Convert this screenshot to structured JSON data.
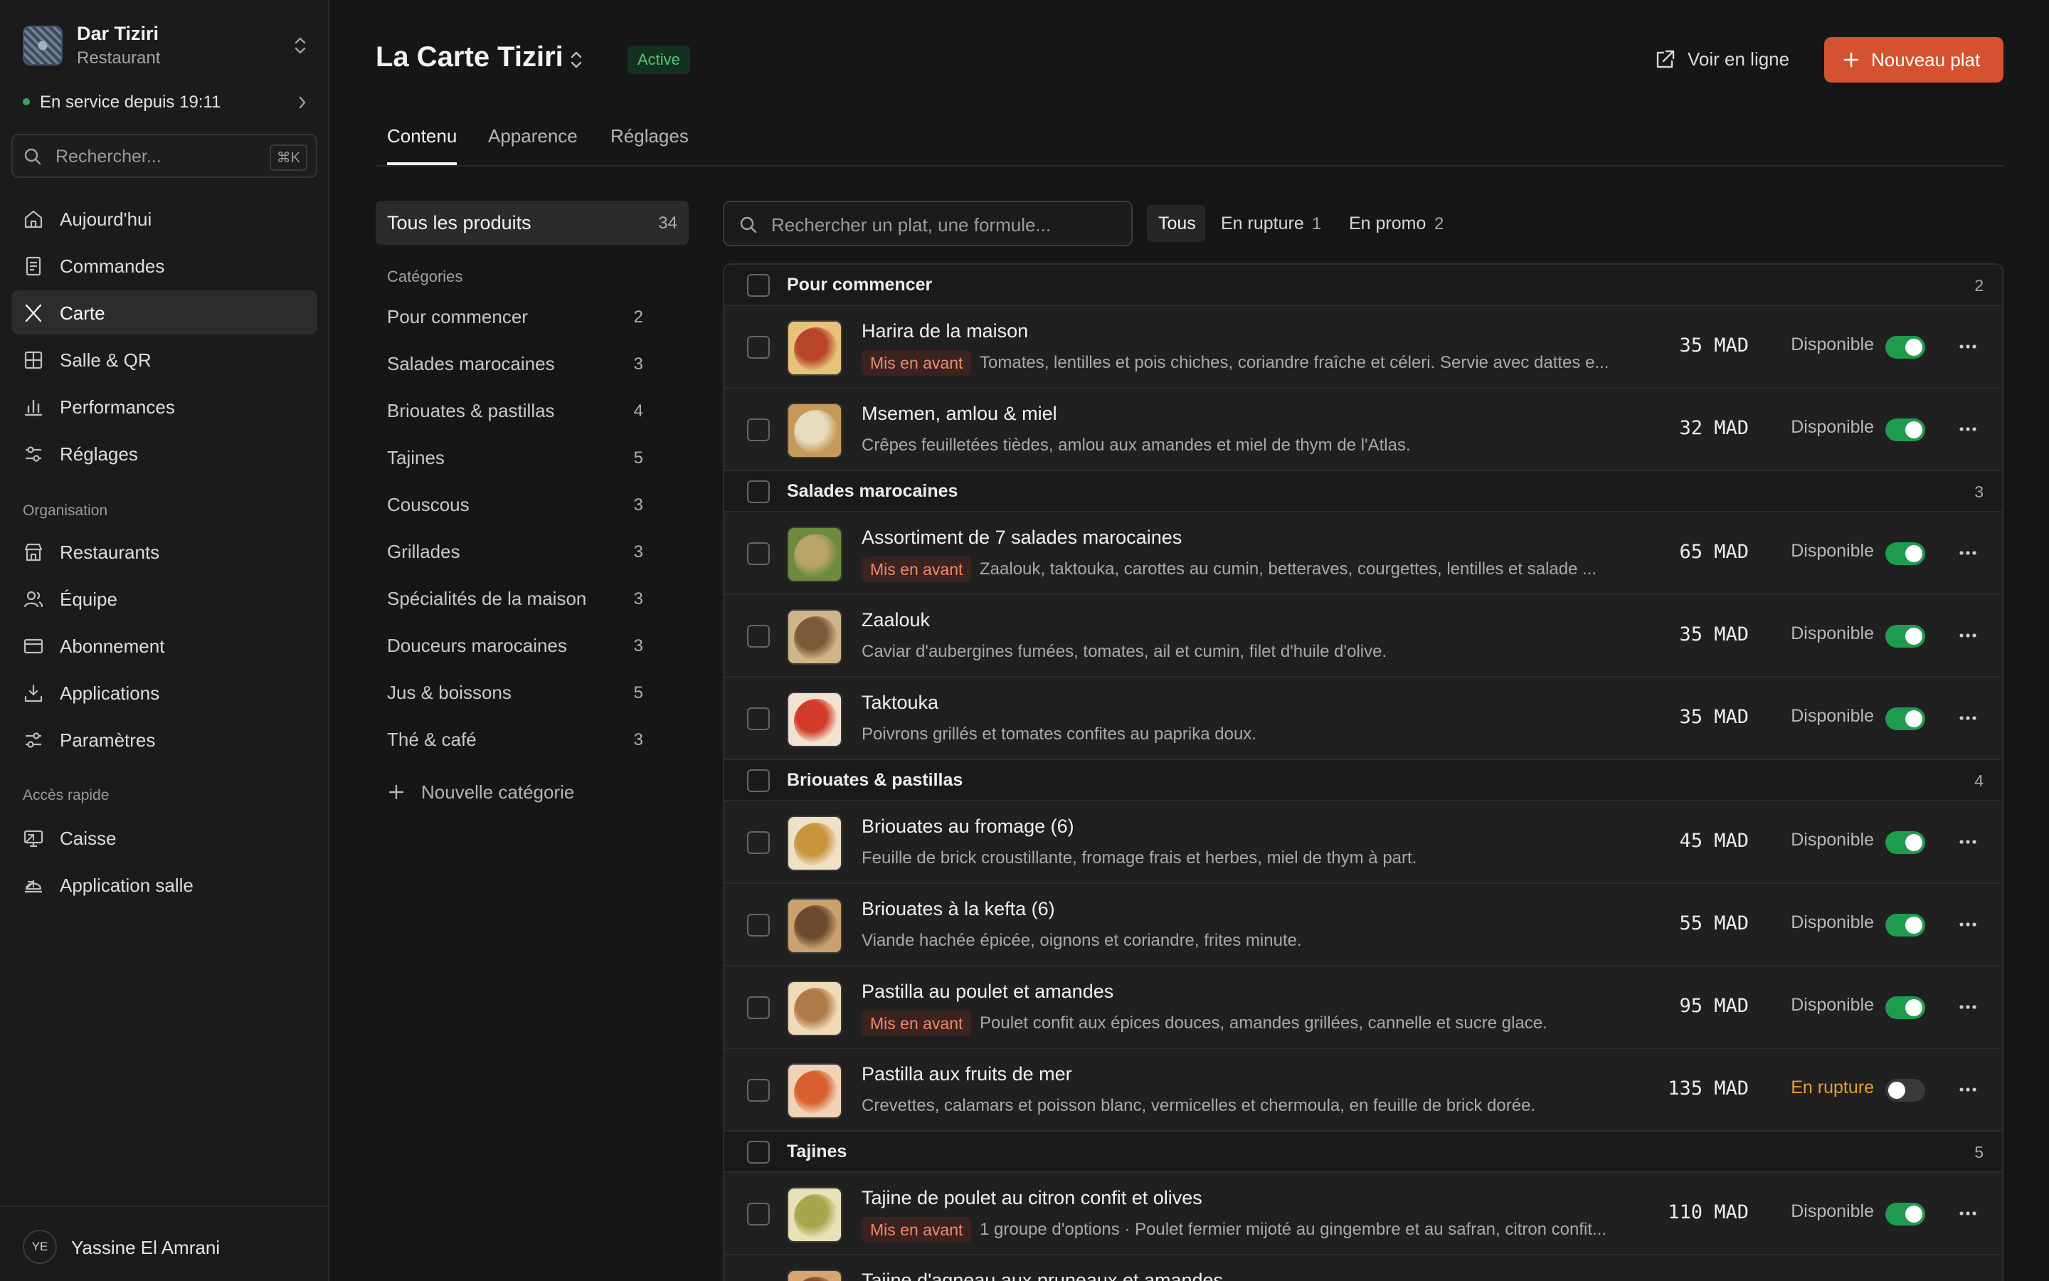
{
  "org": {
    "name": "Dar Tiziri",
    "type": "Restaurant"
  },
  "service": {
    "status": "En service depuis 19:11",
    "color": "#3ba55c"
  },
  "sidebar_search": {
    "placeholder": "Rechercher...",
    "shortcut": "⌘K"
  },
  "nav": [
    {
      "label": "Aujourd'hui",
      "icon": "home-icon"
    },
    {
      "label": "Commandes",
      "icon": "receipt-icon"
    },
    {
      "label": "Carte",
      "icon": "utensils-icon",
      "active": true
    },
    {
      "label": "Salle & QR",
      "icon": "grid-icon"
    },
    {
      "label": "Performances",
      "icon": "bar-chart-icon"
    },
    {
      "label": "Réglages",
      "icon": "sliders-icon"
    }
  ],
  "org_section": {
    "title": "Organisation",
    "items": [
      {
        "label": "Restaurants",
        "icon": "store-icon"
      },
      {
        "label": "Équipe",
        "icon": "users-icon"
      },
      {
        "label": "Abonnement",
        "icon": "credit-card-icon"
      },
      {
        "label": "Applications",
        "icon": "download-icon"
      },
      {
        "label": "Paramètres",
        "icon": "settings-sliders-icon"
      }
    ]
  },
  "quick_section": {
    "title": "Accès rapide",
    "items": [
      {
        "label": "Caisse",
        "icon": "monitor-icon"
      },
      {
        "label": "Application salle",
        "icon": "service-bell-icon"
      }
    ]
  },
  "user": {
    "initials": "YE",
    "name": "Yassine El Amrani"
  },
  "header": {
    "title": "La Carte Tiziri",
    "status": "Active",
    "view_online": "Voir en ligne",
    "new_dish": "Nouveau plat",
    "accent": "#d4522f"
  },
  "tabs": [
    "Contenu",
    "Apparence",
    "Réglages"
  ],
  "categories": {
    "all_label": "Tous les produits",
    "all_count": "34",
    "heading": "Catégories",
    "items": [
      {
        "label": "Pour commencer",
        "count": "2"
      },
      {
        "label": "Salades marocaines",
        "count": "3"
      },
      {
        "label": "Briouates & pastillas",
        "count": "4"
      },
      {
        "label": "Tajines",
        "count": "5"
      },
      {
        "label": "Couscous",
        "count": "3"
      },
      {
        "label": "Grillades",
        "count": "3"
      },
      {
        "label": "Spécialités de la maison",
        "count": "3"
      },
      {
        "label": "Douceurs marocaines",
        "count": "3"
      },
      {
        "label": "Jus & boissons",
        "count": "5"
      },
      {
        "label": "Thé & café",
        "count": "3"
      }
    ],
    "add_label": "Nouvelle catégorie"
  },
  "product_search": {
    "placeholder": "Rechercher un plat, une formule..."
  },
  "filters": [
    {
      "label": "Tous",
      "count": ""
    },
    {
      "label": "En rupture",
      "count": "1"
    },
    {
      "label": "En promo",
      "count": "2"
    }
  ],
  "table": {
    "featured_label": "Mis en avant",
    "groups": [
      {
        "label": "Pour commencer",
        "count": "2",
        "items": [
          {
            "name": "Harira de la maison",
            "featured": true,
            "desc": "Tomates, lentilles et pois chiches, coriandre fraîche et céleri. Servie avec dattes e...",
            "price": "35 MAD",
            "status": "Disponible",
            "available": true
          },
          {
            "name": "Msemen, amlou & miel",
            "featured": false,
            "desc": "Crêpes feuilletées tièdes, amlou aux amandes et miel de thym de l'Atlas.",
            "price": "32 MAD",
            "status": "Disponible",
            "available": true
          }
        ]
      },
      {
        "label": "Salades marocaines",
        "count": "3",
        "items": [
          {
            "name": "Assortiment de 7 salades marocaines",
            "featured": true,
            "desc": "Zaalouk, taktouka, carottes au cumin, betteraves, courgettes, lentilles et salade ...",
            "price": "65 MAD",
            "status": "Disponible",
            "available": true
          },
          {
            "name": "Zaalouk",
            "featured": false,
            "desc": "Caviar d'aubergines fumées, tomates, ail et cumin, filet d'huile d'olive.",
            "price": "35 MAD",
            "status": "Disponible",
            "available": true
          },
          {
            "name": "Taktouka",
            "featured": false,
            "desc": "Poivrons grillés et tomates confites au paprika doux.",
            "price": "35 MAD",
            "status": "Disponible",
            "available": true
          }
        ]
      },
      {
        "label": "Briouates & pastillas",
        "count": "4",
        "items": [
          {
            "name": "Briouates au fromage (6)",
            "featured": false,
            "desc": "Feuille de brick croustillante, fromage frais et herbes, miel de thym à part.",
            "price": "45 MAD",
            "status": "Disponible",
            "available": true
          },
          {
            "name": "Briouates à la kefta (6)",
            "featured": false,
            "desc": "Viande hachée épicée, oignons et coriandre, frites minute.",
            "price": "55 MAD",
            "status": "Disponible",
            "available": true
          },
          {
            "name": "Pastilla au poulet et amandes",
            "featured": true,
            "desc": "Poulet confit aux épices douces, amandes grillées, cannelle et sucre glace.",
            "price": "95 MAD",
            "status": "Disponible",
            "available": true
          },
          {
            "name": "Pastilla aux fruits de mer",
            "featured": false,
            "desc": "Crevettes, calamars et poisson blanc, vermicelles et chermoula, en feuille de brick dorée.",
            "price": "135 MAD",
            "status": "En rupture",
            "available": false
          }
        ]
      },
      {
        "label": "Tajines",
        "count": "5",
        "items": [
          {
            "name": "Tajine de poulet au citron confit et olives",
            "featured": true,
            "desc": "1 groupe d'options · Poulet fermier mijoté au gingembre et au safran, citron confit...",
            "price": "110 MAD",
            "status": "Disponible",
            "available": true
          },
          {
            "name": "Tajine d'agneau aux pruneaux et amandes",
            "featured": false,
            "desc": "",
            "price": "",
            "status": "",
            "available": true
          }
        ]
      }
    ]
  }
}
